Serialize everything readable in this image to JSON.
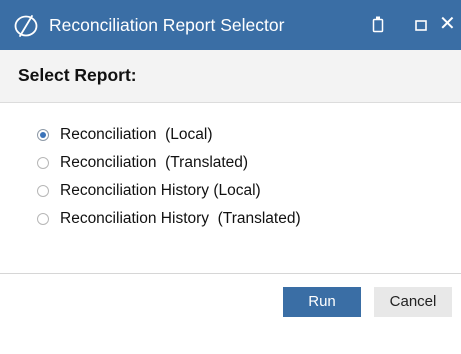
{
  "window": {
    "title": "Reconciliation Report Selector"
  },
  "header": {
    "heading": "Select Report:"
  },
  "options": [
    {
      "label": "Reconciliation  (Local)",
      "selected": true
    },
    {
      "label": "Reconciliation  (Translated)",
      "selected": false
    },
    {
      "label": "Reconciliation History (Local)",
      "selected": false
    },
    {
      "label": "Reconciliation History  (Translated)",
      "selected": false
    }
  ],
  "buttons": {
    "run": "Run",
    "cancel": "Cancel"
  },
  "colors": {
    "titlebar": "#3a6ea5",
    "accent": "#3b73b9",
    "header_band": "#f3f3f3",
    "cancel_bg": "#e8e8e8"
  },
  "icons": {
    "title_logo": "app-logo-icon",
    "restore": "restore-icon",
    "maximize": "maximize-icon",
    "close": "close-icon"
  }
}
